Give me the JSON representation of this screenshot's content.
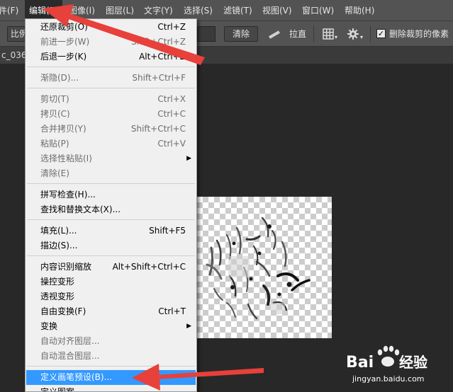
{
  "menubar": {
    "items": [
      {
        "label": "件(F)"
      },
      {
        "label": "编辑(E)"
      },
      {
        "label": "图像(I)"
      },
      {
        "label": "图层(L)"
      },
      {
        "label": "文字(Y)"
      },
      {
        "label": "选择(S)"
      },
      {
        "label": "滤镜(T)"
      },
      {
        "label": "视图(V)"
      },
      {
        "label": "窗口(W)"
      },
      {
        "label": "帮助(H)"
      }
    ]
  },
  "options_bar": {
    "ratio_label": "比例",
    "clear_label": "清除",
    "straighten_label": "拉直",
    "delete_cropped_label": "删除裁剪的像素",
    "delete_cropped_checked": true
  },
  "document_tab": {
    "label": "c_036"
  },
  "edit_menu": {
    "items": [
      {
        "label": "还原裁剪(O)",
        "shortcut": "Ctrl+Z",
        "disabled": false
      },
      {
        "label": "前进一步(W)",
        "shortcut": "Shift+Ctrl+Z",
        "disabled": true
      },
      {
        "label": "后退一步(K)",
        "shortcut": "Alt+Ctrl+Z",
        "disabled": false
      },
      {
        "label": "渐隐(D)...",
        "shortcut": "Shift+Ctrl+F",
        "disabled": true
      },
      {
        "label": "剪切(T)",
        "shortcut": "Ctrl+X",
        "disabled": true
      },
      {
        "label": "拷贝(C)",
        "shortcut": "Ctrl+C",
        "disabled": true
      },
      {
        "label": "合并拷贝(Y)",
        "shortcut": "Shift+Ctrl+C",
        "disabled": true
      },
      {
        "label": "粘贴(P)",
        "shortcut": "Ctrl+V",
        "disabled": true
      },
      {
        "label": "选择性粘贴(I)",
        "shortcut": "",
        "disabled": true
      },
      {
        "label": "清除(E)",
        "shortcut": "",
        "disabled": true
      },
      {
        "label": "拼写检查(H)...",
        "shortcut": "",
        "disabled": false
      },
      {
        "label": "查找和替换文本(X)...",
        "shortcut": "",
        "disabled": false
      },
      {
        "label": "填充(L)...",
        "shortcut": "Shift+F5",
        "disabled": false
      },
      {
        "label": "描边(S)...",
        "shortcut": "",
        "disabled": false
      },
      {
        "label": "内容识别缩放",
        "shortcut": "Alt+Shift+Ctrl+C",
        "disabled": false
      },
      {
        "label": "操控变形",
        "shortcut": "",
        "disabled": false
      },
      {
        "label": "透视变形",
        "shortcut": "",
        "disabled": false
      },
      {
        "label": "自由变换(F)",
        "shortcut": "Ctrl+T",
        "disabled": false
      },
      {
        "label": "变换",
        "shortcut": "",
        "disabled": false
      },
      {
        "label": "自动对齐图层...",
        "shortcut": "",
        "disabled": true
      },
      {
        "label": "自动混合图层...",
        "shortcut": "",
        "disabled": true
      },
      {
        "label": "定义画笔预设(B)...",
        "shortcut": "",
        "disabled": false
      },
      {
        "label": "定义图案",
        "shortcut": "",
        "disabled": false
      }
    ]
  },
  "watermark": {
    "brand": "Bai",
    "brand_suffix": "经验",
    "url": "jingyan.baidu.com"
  },
  "colors": {
    "menubar_bg": "#535353",
    "menu_bg": "#f0f0f0",
    "highlight": "#3399ff",
    "arrow": "#e8403a"
  }
}
